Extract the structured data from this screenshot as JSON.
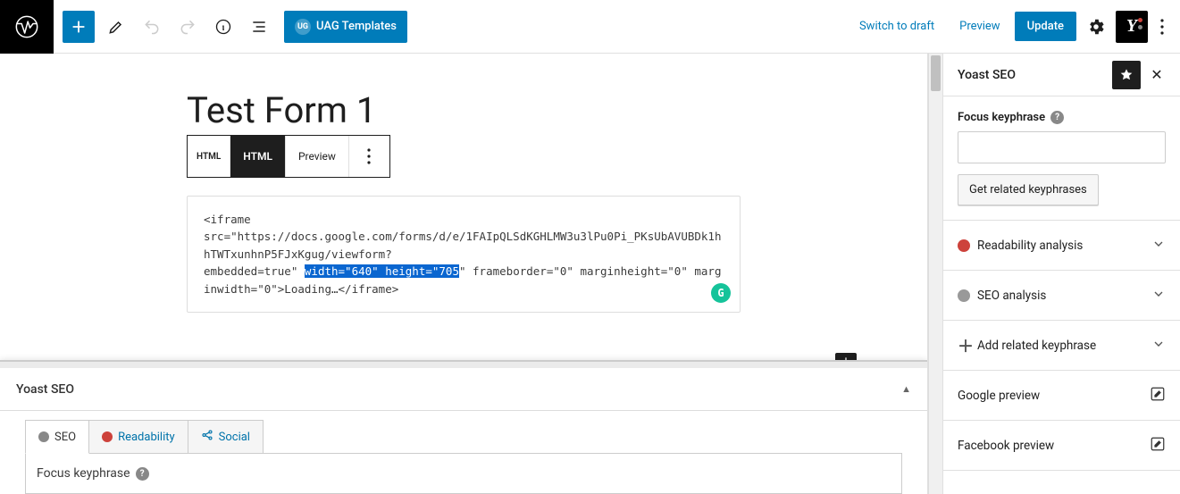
{
  "topbar": {
    "uag_label": "UAG Templates",
    "switch_draft": "Switch to draft",
    "preview": "Preview",
    "update": "Update"
  },
  "page": {
    "title": "Test Form 1"
  },
  "block_toolbar": {
    "icon_label": "HTML",
    "html_tab": "HTML",
    "preview_tab": "Preview"
  },
  "code": {
    "line1": "<iframe",
    "line2a": "src=\"https://docs.google.com/forms/d/e/1FAIpQLSdKGHLMW3u3lPu0Pi_PKsUbAVUBDk1hhTWTxunhnP5FJxKgug/viewform?",
    "line3a": "embedded=true\" ",
    "sel": "width=\"640\" height=\"705",
    "line3b": "\" frameborder=\"0\" marginheight=\"0\" marginwidth=\"0\">Loading…</iframe>"
  },
  "bottom": {
    "title": "Yoast SEO",
    "tab_seo": "SEO",
    "tab_read": "Readability",
    "tab_social": "Social",
    "focus_label": "Focus keyphrase"
  },
  "sidebar": {
    "title": "Yoast SEO",
    "focus_label": "Focus keyphrase",
    "related_btn": "Get related keyphrases",
    "readability": "Readability analysis",
    "seo_analysis": "SEO analysis",
    "add_related": "Add related keyphrase",
    "google_preview": "Google preview",
    "facebook_preview": "Facebook preview"
  }
}
